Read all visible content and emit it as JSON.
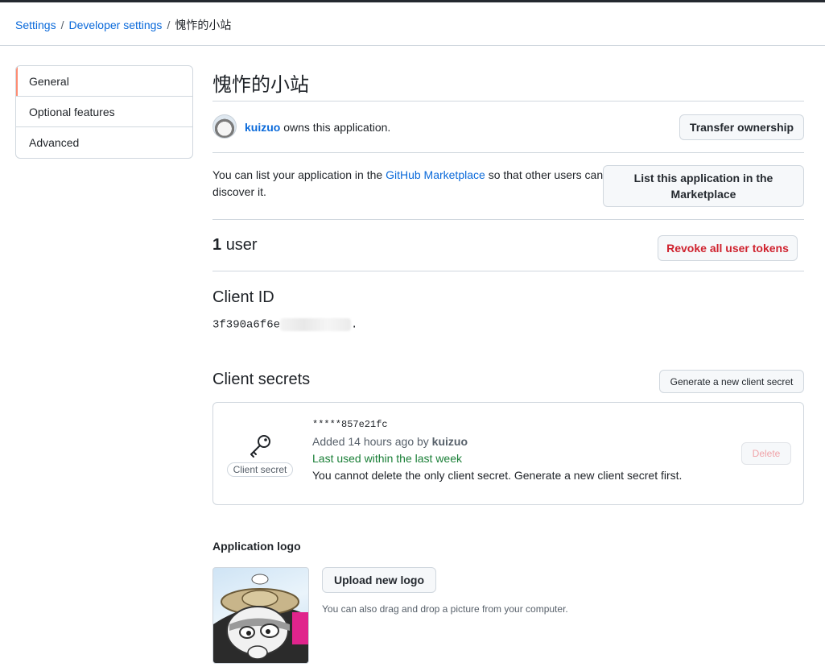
{
  "breadcrumb": {
    "settings": "Settings",
    "developer": "Developer settings",
    "sep": "/",
    "current": "愧怍的小站"
  },
  "sidebar": {
    "items": [
      {
        "label": "General"
      },
      {
        "label": "Optional features"
      },
      {
        "label": "Advanced"
      }
    ]
  },
  "app": {
    "title": "愧怍的小站",
    "owner_user": "kuizuo",
    "owner_suffix": "owns this application.",
    "transfer_label": "Transfer ownership"
  },
  "marketplace": {
    "text_before": "You can list your application in the",
    "link": "GitHub Marketplace",
    "text_after": "so that other users can discover it.",
    "button": "List this application in the Marketplace"
  },
  "users": {
    "count": "1",
    "label": "user",
    "revoke_label": "Revoke all user tokens"
  },
  "client_id": {
    "heading": "Client ID",
    "value": "3f390a6f6e",
    "suffix": "."
  },
  "client_secrets": {
    "heading": "Client secrets",
    "generate_label": "Generate a new client secret",
    "secret_label": "Client secret",
    "masked": "*****857e21fc",
    "added_prefix": "Added 14 hours ago by",
    "added_user": "kuizuo",
    "last_used": "Last used within the last week",
    "warning": "You cannot delete the only client secret. Generate a new client secret first.",
    "delete_label": "Delete"
  },
  "logo": {
    "heading": "Application logo",
    "upload_label": "Upload new logo",
    "hint": "You can also drag and drop a picture from your computer."
  },
  "colors": {
    "link": "#0969da",
    "danger": "#cf222e",
    "success": "#1a7f37",
    "active_marker": "#fd8c73",
    "border": "#d0d7de"
  }
}
